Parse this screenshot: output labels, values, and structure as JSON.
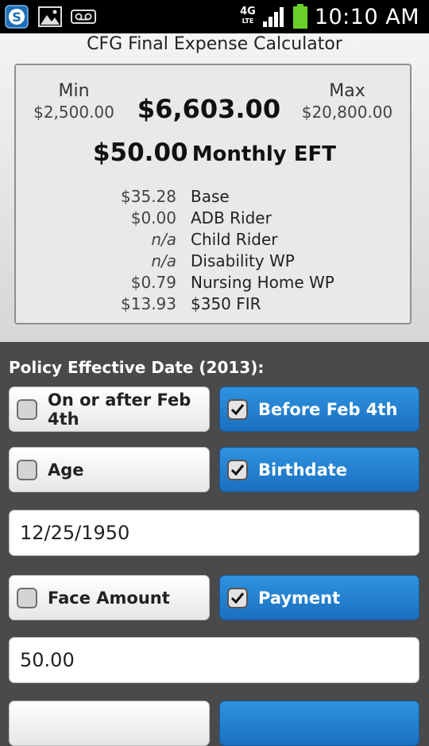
{
  "status_bar": {
    "time": "10:10 AM",
    "network": "4G",
    "network_sub": "LTE"
  },
  "app": {
    "title": "CFG Final Expense Calculator"
  },
  "summary": {
    "min_label": "Min",
    "min_value": "$2,500.00",
    "max_label": "Max",
    "max_value": "$20,800.00",
    "face_amount": "$6,603.00",
    "monthly_amount": "$50.00",
    "monthly_label": "Monthly EFT",
    "breakdown": [
      {
        "value": "$35.28",
        "name": "Base"
      },
      {
        "value": "$0.00",
        "name": "ADB Rider"
      },
      {
        "value": "n/a",
        "name": "Child Rider"
      },
      {
        "value": "n/a",
        "name": "Disability WP"
      },
      {
        "value": "$0.79",
        "name": "Nursing Home WP"
      },
      {
        "value": "$13.93",
        "name": "$350 FIR"
      }
    ]
  },
  "form": {
    "effective_date_title": "Policy Effective Date (2013):",
    "date_options": [
      {
        "label": "On or after Feb 4th",
        "checked": false
      },
      {
        "label": "Before Feb 4th",
        "checked": true
      }
    ],
    "age_options": [
      {
        "label": "Age",
        "checked": false
      },
      {
        "label": "Birthdate",
        "checked": true
      }
    ],
    "birthdate_value": "12/25/1950",
    "calc_options": [
      {
        "label": "Face Amount",
        "checked": false
      },
      {
        "label": "Payment",
        "checked": true
      }
    ],
    "payment_value": "50.00"
  },
  "colors": {
    "selected": "#1f7fd0",
    "unselected": "#f2f2f2",
    "background": "#4a4a4a"
  }
}
